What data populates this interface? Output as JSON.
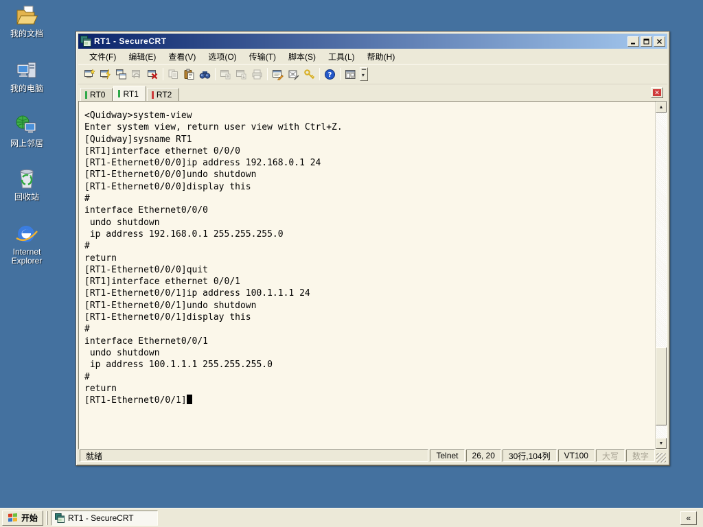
{
  "colors": {
    "desktop_bg": "#44719f",
    "titlebar_start": "#0a246a",
    "titlebar_end": "#a6caf0",
    "terminal_bg": "#fbf7ea",
    "tab_connected": "#2fa848",
    "tab_disconnected": "#cc3a3a"
  },
  "desktop": {
    "icons": [
      {
        "id": "my-documents",
        "label": "我的文档"
      },
      {
        "id": "my-computer",
        "label": "我的电脑"
      },
      {
        "id": "network-places",
        "label": "网上邻居"
      },
      {
        "id": "recycle-bin",
        "label": "回收站"
      },
      {
        "id": "internet-explorer",
        "label": "Internet Explorer"
      }
    ]
  },
  "window": {
    "title": "RT1 - SecureCRT",
    "menu": [
      {
        "id": "file",
        "label": "文件(F)"
      },
      {
        "id": "edit",
        "label": "编辑(E)"
      },
      {
        "id": "view",
        "label": "查看(V)"
      },
      {
        "id": "options",
        "label": "选项(O)"
      },
      {
        "id": "transfer",
        "label": "传输(T)"
      },
      {
        "id": "script",
        "label": "脚本(S)"
      },
      {
        "id": "tools",
        "label": "工具(L)"
      },
      {
        "id": "help",
        "label": "帮助(H)"
      }
    ],
    "toolbar": [
      {
        "name": "quick-connect-icon",
        "enabled": true
      },
      {
        "name": "connect-icon",
        "enabled": true
      },
      {
        "name": "connect-in-tab-icon",
        "enabled": true
      },
      {
        "name": "reconnect-icon",
        "enabled": false
      },
      {
        "name": "disconnect-icon",
        "enabled": true
      },
      {
        "type": "separator"
      },
      {
        "name": "copy-icon",
        "enabled": false
      },
      {
        "name": "paste-icon",
        "enabled": true
      },
      {
        "name": "find-icon",
        "enabled": true
      },
      {
        "type": "separator"
      },
      {
        "name": "upload-icon",
        "enabled": false
      },
      {
        "name": "download-icon",
        "enabled": false
      },
      {
        "name": "print-icon",
        "enabled": false
      },
      {
        "type": "separator"
      },
      {
        "name": "session-options-icon",
        "enabled": true
      },
      {
        "name": "keymap-editor-icon",
        "enabled": true
      },
      {
        "name": "key-agent-icon",
        "enabled": true
      },
      {
        "type": "separator"
      },
      {
        "name": "help-icon",
        "enabled": true
      },
      {
        "type": "separator"
      },
      {
        "name": "session-manager-icon",
        "enabled": true
      }
    ],
    "tabs": [
      {
        "id": "rt0",
        "label": "RT0",
        "status": "connected",
        "active": false
      },
      {
        "id": "rt1",
        "label": "RT1",
        "status": "connected",
        "active": true
      },
      {
        "id": "rt2",
        "label": "RT2",
        "status": "disconnected",
        "active": false
      }
    ],
    "terminal": {
      "lines": [
        "<Quidway>system-view",
        "Enter system view, return user view with Ctrl+Z.",
        "[Quidway]sysname RT1",
        "[RT1]interface ethernet 0/0/0",
        "[RT1-Ethernet0/0/0]ip address 192.168.0.1 24",
        "[RT1-Ethernet0/0/0]undo shutdown",
        "[RT1-Ethernet0/0/0]display this",
        "#",
        "interface Ethernet0/0/0",
        " undo shutdown",
        " ip address 192.168.0.1 255.255.255.0",
        "#",
        "return",
        "[RT1-Ethernet0/0/0]quit",
        "[RT1]interface ethernet 0/0/1",
        "[RT1-Ethernet0/0/1]ip address 100.1.1.1 24",
        "[RT1-Ethernet0/0/1]undo shutdown",
        "[RT1-Ethernet0/0/1]display this",
        "#",
        "interface Ethernet0/0/1",
        " undo shutdown",
        " ip address 100.1.1.1 255.255.255.0",
        "#",
        "return",
        "[RT1-Ethernet0/0/1]"
      ],
      "cursor": true
    },
    "statusbar": {
      "ready": "就绪",
      "protocol": "Telnet",
      "cursor_pos": "26,  20",
      "size": "30行,104列",
      "emulation": "VT100",
      "caps": "大写",
      "num": "数字"
    }
  },
  "taskbar": {
    "start_label": "开始",
    "task_label": "RT1 - SecureCRT",
    "chevron": "«"
  }
}
